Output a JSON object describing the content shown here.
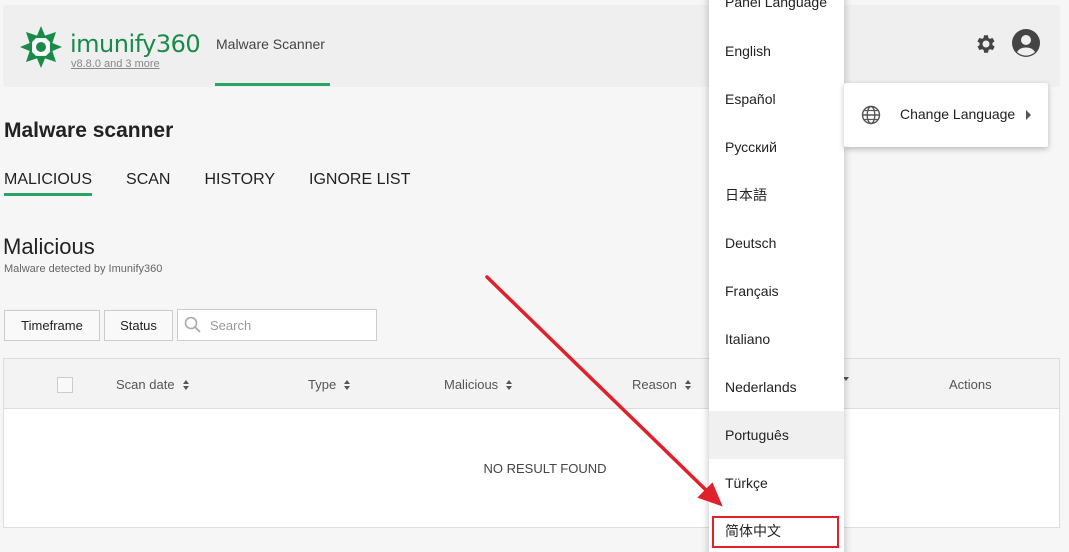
{
  "header": {
    "brand": "imunify360",
    "version": "v8.8.0 and 3 more",
    "nav_tab": "Malware Scanner"
  },
  "page": {
    "title": "Malware scanner",
    "tabs": [
      "MALICIOUS",
      "SCAN",
      "HISTORY",
      "IGNORE LIST"
    ]
  },
  "section": {
    "title": "Malicious",
    "subtitle": "Malware detected by Imunify360"
  },
  "filters": {
    "timeframe": "Timeframe",
    "status": "Status",
    "search_placeholder": "Search"
  },
  "table": {
    "columns": [
      "Scan date",
      "Type",
      "Malicious",
      "Reason",
      "Actions"
    ],
    "empty_text": "NO RESULT FOUND"
  },
  "language_menu": {
    "header": "Panel Language",
    "items": [
      "English",
      "Español",
      "Русский",
      "日本語",
      "Deutsch",
      "Français",
      "Italiano",
      "Nederlands",
      "Português",
      "Türkçe",
      "简体中文"
    ]
  },
  "context_menu": {
    "change_language": "Change Language"
  },
  "colors": {
    "accent": "#2aa466",
    "annotation": "#e0202a"
  }
}
